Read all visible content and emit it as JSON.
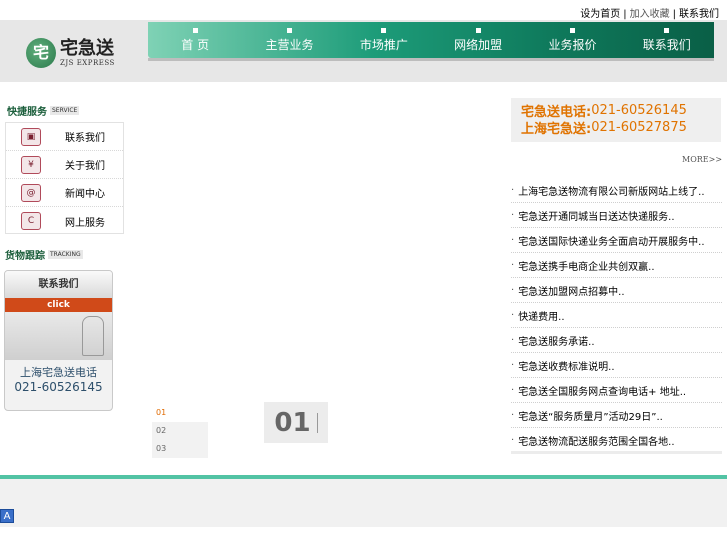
{
  "toplinks": {
    "item1": "设为首页",
    "item2": "加入收藏",
    "item3": "联系我们"
  },
  "logo": {
    "mark": "宅",
    "cn": "宅急送",
    "en": "ZJS EXPRESS"
  },
  "nav": [
    {
      "label": "首 页"
    },
    {
      "label": "主营业务"
    },
    {
      "label": "市场推广"
    },
    {
      "label": "网络加盟"
    },
    {
      "label": "业务报价"
    },
    {
      "label": "联系我们"
    }
  ],
  "service": {
    "title": "快捷服务",
    "title_en": "SERVICE",
    "items": [
      {
        "icon": "▣",
        "label": "联系我们"
      },
      {
        "icon": "¥",
        "label": "关于我们"
      },
      {
        "icon": "@",
        "label": "新闻中心"
      },
      {
        "icon": "C",
        "label": "网上服务"
      }
    ]
  },
  "tracking": {
    "title": "货物跟踪",
    "title_en": "TRACKING",
    "button": "联系我们",
    "click": "click",
    "label": "上海宅急送电话",
    "phone": "021-60526145"
  },
  "slider": {
    "nums": [
      "01",
      "02",
      "03"
    ],
    "current": "01"
  },
  "phones": [
    {
      "cn": "宅急送电话:",
      "num": "021-60526145"
    },
    {
      "cn": "上海宅急送:",
      "num": "021-60527875"
    }
  ],
  "more": "MORE>>",
  "news": [
    "上海宅急送物流有限公司新版网站上线了..",
    "宅急送开通同城当日送达快递服务..",
    "宅急送国际快递业务全面启动开展服务中..",
    "宅急送携手电商企业共创双赢..",
    "宅急送加盟网点招募中..",
    "快递费用..",
    "宅急送服务承诺..",
    "宅急送收费标准说明..",
    "宅急送全国服务网点查询电话+ 地址..",
    "宅急送“服务质量月”活动29日”..",
    "宅急送物流配送服务范围全国各地.."
  ],
  "footer": {
    "icon": "A"
  }
}
